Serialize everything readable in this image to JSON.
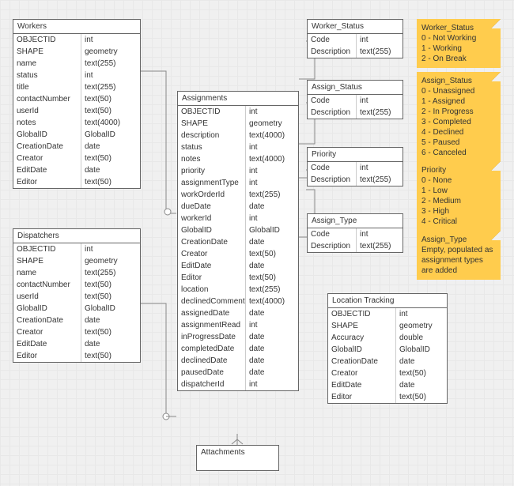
{
  "entities": {
    "workers": {
      "title": "Workers",
      "rows": [
        {
          "name": "OBJECTID",
          "type": "int"
        },
        {
          "name": "SHAPE",
          "type": "geometry"
        },
        {
          "name": "name",
          "type": "text(255)"
        },
        {
          "name": "status",
          "type": "int"
        },
        {
          "name": "title",
          "type": "text(255)"
        },
        {
          "name": "contactNumber",
          "type": "text(50)"
        },
        {
          "name": "userId",
          "type": "text(50)"
        },
        {
          "name": "notes",
          "type": "text(4000)"
        },
        {
          "name": "GlobalID",
          "type": "GlobalID"
        },
        {
          "name": "CreationDate",
          "type": "date"
        },
        {
          "name": "Creator",
          "type": "text(50)"
        },
        {
          "name": "EditDate",
          "type": "date"
        },
        {
          "name": "Editor",
          "type": "text(50)"
        }
      ]
    },
    "dispatchers": {
      "title": "Dispatchers",
      "rows": [
        {
          "name": "OBJECTID",
          "type": "int"
        },
        {
          "name": "SHAPE",
          "type": "geometry"
        },
        {
          "name": "name",
          "type": "text(255)"
        },
        {
          "name": "contactNumber",
          "type": "text(50)"
        },
        {
          "name": "userId",
          "type": "text(50)"
        },
        {
          "name": "GlobalID",
          "type": "GlobalID"
        },
        {
          "name": "CreationDate",
          "type": "date"
        },
        {
          "name": "Creator",
          "type": "text(50)"
        },
        {
          "name": "EditDate",
          "type": "date"
        },
        {
          "name": "Editor",
          "type": "text(50)"
        }
      ]
    },
    "assignments": {
      "title": "Assignments",
      "rows": [
        {
          "name": "OBJECTID",
          "type": "int"
        },
        {
          "name": "SHAPE",
          "type": "geometry"
        },
        {
          "name": "description",
          "type": "text(4000)"
        },
        {
          "name": "status",
          "type": "int"
        },
        {
          "name": "notes",
          "type": "text(4000)"
        },
        {
          "name": "priority",
          "type": "int"
        },
        {
          "name": "assignmentType",
          "type": "int"
        },
        {
          "name": "workOrderId",
          "type": "text(255)"
        },
        {
          "name": "dueDate",
          "type": "date"
        },
        {
          "name": "workerId",
          "type": "int"
        },
        {
          "name": "GlobalID",
          "type": "GlobalID"
        },
        {
          "name": "CreationDate",
          "type": "date"
        },
        {
          "name": "Creator",
          "type": "text(50)"
        },
        {
          "name": "EditDate",
          "type": "date"
        },
        {
          "name": "Editor",
          "type": "text(50)"
        },
        {
          "name": "location",
          "type": "text(255)"
        },
        {
          "name": "declinedComment",
          "type": "text(4000)"
        },
        {
          "name": "assignedDate",
          "type": "date"
        },
        {
          "name": "assignmentRead",
          "type": "int"
        },
        {
          "name": "inProgressDate",
          "type": "date"
        },
        {
          "name": "completedDate",
          "type": "date"
        },
        {
          "name": "declinedDate",
          "type": "date"
        },
        {
          "name": "pausedDate",
          "type": "date"
        },
        {
          "name": "dispatcherId",
          "type": "int"
        }
      ]
    },
    "worker_status": {
      "title": "Worker_Status",
      "rows": [
        {
          "name": "Code",
          "type": "int"
        },
        {
          "name": "Description",
          "type": "text(255)"
        }
      ]
    },
    "assign_status": {
      "title": "Assign_Status",
      "rows": [
        {
          "name": "Code",
          "type": "int"
        },
        {
          "name": "Description",
          "type": "text(255)"
        }
      ]
    },
    "priority": {
      "title": "Priority",
      "rows": [
        {
          "name": "Code",
          "type": "int"
        },
        {
          "name": "Description",
          "type": "text(255)"
        }
      ]
    },
    "assign_type": {
      "title": "Assign_Type",
      "rows": [
        {
          "name": "Code",
          "type": "int"
        },
        {
          "name": "Description",
          "type": "text(255)"
        }
      ]
    },
    "location_tracking": {
      "title": "Location Tracking",
      "rows": [
        {
          "name": "OBJECTID",
          "type": "int"
        },
        {
          "name": "SHAPE",
          "type": "geometry"
        },
        {
          "name": "Accuracy",
          "type": "double"
        },
        {
          "name": "GlobalID",
          "type": "GlobalID"
        },
        {
          "name": "CreationDate",
          "type": "date"
        },
        {
          "name": "Creator",
          "type": "text(50)"
        },
        {
          "name": "EditDate",
          "type": "date"
        },
        {
          "name": "Editor",
          "type": "text(50)"
        }
      ]
    },
    "attachments": {
      "title": "Attachments"
    }
  },
  "notes": {
    "worker_status": {
      "title": "Worker_Status",
      "lines": [
        "0 - Not Working",
        "1 - Working",
        "2 - On Break"
      ]
    },
    "assign_status": {
      "title": "Assign_Status",
      "lines": [
        "0 - Unassigned",
        "1 - Assigned",
        "2 - In Progress",
        "3 - Completed",
        "4 - Declined",
        "5 - Paused",
        "6 - Canceled"
      ]
    },
    "priority": {
      "title": "Priority",
      "lines": [
        "0 - None",
        "1 - Low",
        "2 - Medium",
        "3 - High",
        "4 - Critical"
      ]
    },
    "assign_type": {
      "title": "Assign_Type",
      "lines": [
        "Empty, populated as",
        "assignment types are added"
      ]
    }
  }
}
